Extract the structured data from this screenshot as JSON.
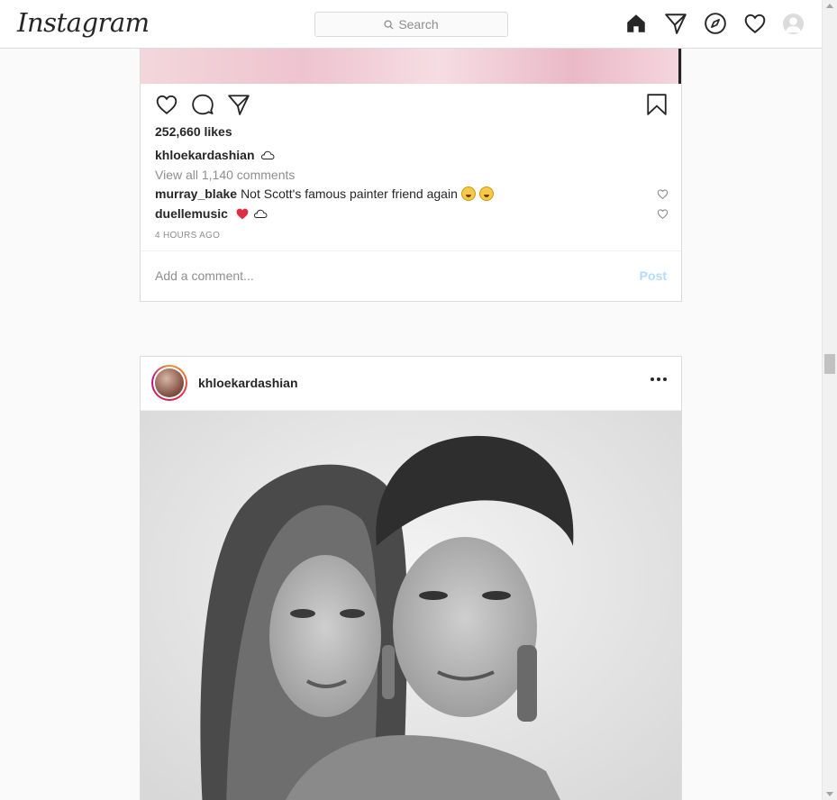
{
  "nav": {
    "logo": "Instagram",
    "search_placeholder": "Search",
    "icons": [
      "home-icon",
      "direct-icon",
      "explore-icon",
      "activity-heart-icon",
      "profile-avatar"
    ]
  },
  "post1": {
    "likes": "252,660 likes",
    "caption_user": "khloekardashian",
    "view_comments": "View all 1,140 comments",
    "comments": [
      {
        "user": "murray_blake",
        "text": "Not Scott's famous painter friend again"
      },
      {
        "user": "duellemusic",
        "text": ""
      }
    ],
    "timestamp": "4 HOURS AGO",
    "comment_placeholder": "Add a comment...",
    "post_label": "Post"
  },
  "post2": {
    "username": "khloekardashian"
  },
  "colors": {
    "accent_link": "#b3dbff",
    "border": "#dbdbdb",
    "muted_text": "#8e8e8e"
  }
}
